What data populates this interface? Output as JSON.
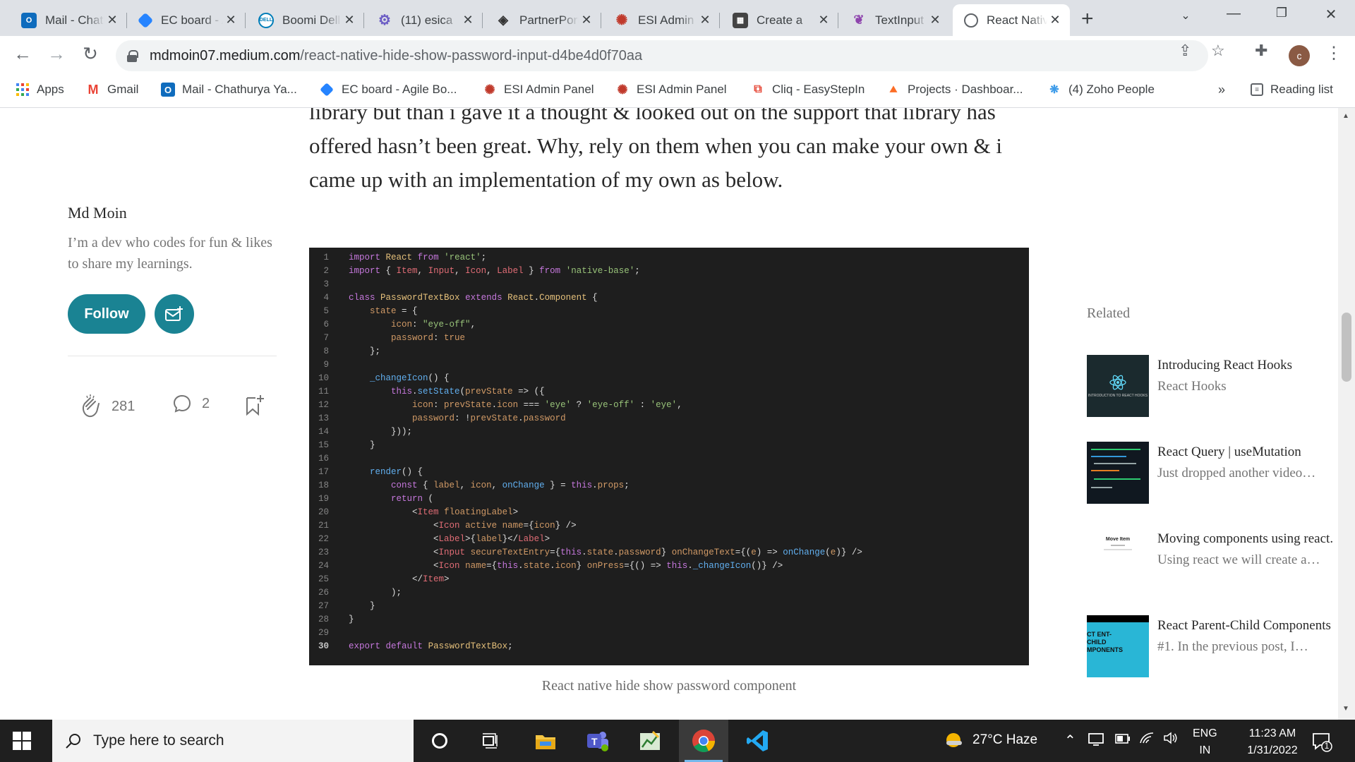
{
  "browser": {
    "tabs": [
      {
        "title": "Mail - Chathurya",
        "icon": "outlook-icon",
        "color": "#0f6cbd"
      },
      {
        "title": "EC board - Agile",
        "icon": "jira-icon",
        "color": "#2684ff"
      },
      {
        "title": "Boomi Dell",
        "icon": "dell-icon",
        "color": "#007db8"
      },
      {
        "title": "(11) esica",
        "icon": "gear-icon",
        "color": "#6b5cc4"
      },
      {
        "title": "PartnerPortal",
        "icon": "partner-icon",
        "color": "#333333"
      },
      {
        "title": "ESI Admin Panel",
        "icon": "esi-icon",
        "color": "#c0392b"
      },
      {
        "title": "Create a",
        "icon": "create-icon",
        "color": "#444444"
      },
      {
        "title": "TextInput",
        "icon": "feather-icon",
        "color": "#8e44ad"
      },
      {
        "title": "React Native",
        "icon": "globe-icon",
        "color": "#5f6368"
      }
    ],
    "active_tab_index": 8,
    "url_domain": "mdmoin07.medium.com",
    "url_path": "/react-native-hide-show-password-input-d4be4d0f70aa",
    "profile_initial": "c"
  },
  "bookmarks": {
    "items": [
      {
        "label": "Apps",
        "icon": "apps-grid-icon"
      },
      {
        "label": "Gmail",
        "icon": "gmail-icon"
      },
      {
        "label": "Mail - Chathurya Ya...",
        "icon": "outlook-icon"
      },
      {
        "label": "EC board - Agile Bo...",
        "icon": "jira-icon"
      },
      {
        "label": "ESI Admin Panel",
        "icon": "esi-icon"
      },
      {
        "label": "ESI Admin Panel",
        "icon": "esi-icon"
      },
      {
        "label": "Cliq - EasyStepIn",
        "icon": "cliq-icon"
      },
      {
        "label": "Projects · Dashboar...",
        "icon": "gitlab-icon"
      },
      {
        "label": "(4) Zoho People",
        "icon": "zoho-icon"
      }
    ],
    "more": "»",
    "reading_list": "Reading list"
  },
  "article": {
    "paragraph": "library but than i gave it a thought & looked out on the support that library has offered hasn’t been great. Why, rely on them when you can make your own & i came up with an implementation of my own as below.",
    "caption": "React native hide show password component"
  },
  "author": {
    "name": "Md Moin",
    "bio": "I’m a dev who codes for fun & likes to share my learnings.",
    "follow_label": "Follow",
    "claps": "281",
    "comments": "2"
  },
  "code": {
    "current_line": 30,
    "lines": [
      "import React from 'react';",
      "import { Item, Input, Icon, Label } from 'native-base';",
      "",
      "class PasswordTextBox extends React.Component {",
      "    state = {",
      "        icon: \"eye-off\",",
      "        password: true",
      "    };",
      "",
      "    _changeIcon() {",
      "        this.setState(prevState => ({",
      "            icon: prevState.icon === 'eye' ? 'eye-off' : 'eye',",
      "            password: !prevState.password",
      "        }));",
      "    }",
      "",
      "    render() {",
      "        const { label, icon, onChange } = this.props;",
      "        return (",
      "            <Item floatingLabel>",
      "                <Icon active name={icon} />",
      "                <Label>{label}</Label>",
      "                <Input secureTextEntry={this.state.password} onChangeText={(e) => onChange(e)} />",
      "                <Icon name={this.state.icon} onPress={() => this._changeIcon()} />",
      "            </Item>",
      "        );",
      "    }",
      "}",
      "",
      "export default PasswordTextBox;"
    ]
  },
  "related": {
    "heading": "Related",
    "items": [
      {
        "title": "Introducing React Hooks",
        "subtitle": "React Hooks",
        "thumb_text": "INTRODUCTION TO REACT HOOKS"
      },
      {
        "title": "React Query | useMutation",
        "subtitle": "Just dropped another video…",
        "thumb_text": ""
      },
      {
        "title": "Moving components using react.",
        "subtitle": "Using react we will create a…",
        "thumb_text": "Move Item"
      },
      {
        "title": "React Parent-Child Components",
        "subtitle": "#1. In the previous post, I…",
        "thumb_text": "CT ENT-CHILD MPONENTS"
      }
    ]
  },
  "taskbar": {
    "search_placeholder": "Type here to search",
    "weather": "27°C  Haze",
    "lang_top": "ENG",
    "lang_bottom": "IN",
    "time": "11:23 AM",
    "date": "1/31/2022",
    "notifications": "1"
  },
  "colors": {
    "accent": "#1a8393",
    "code_bg": "#1e1e1e"
  }
}
